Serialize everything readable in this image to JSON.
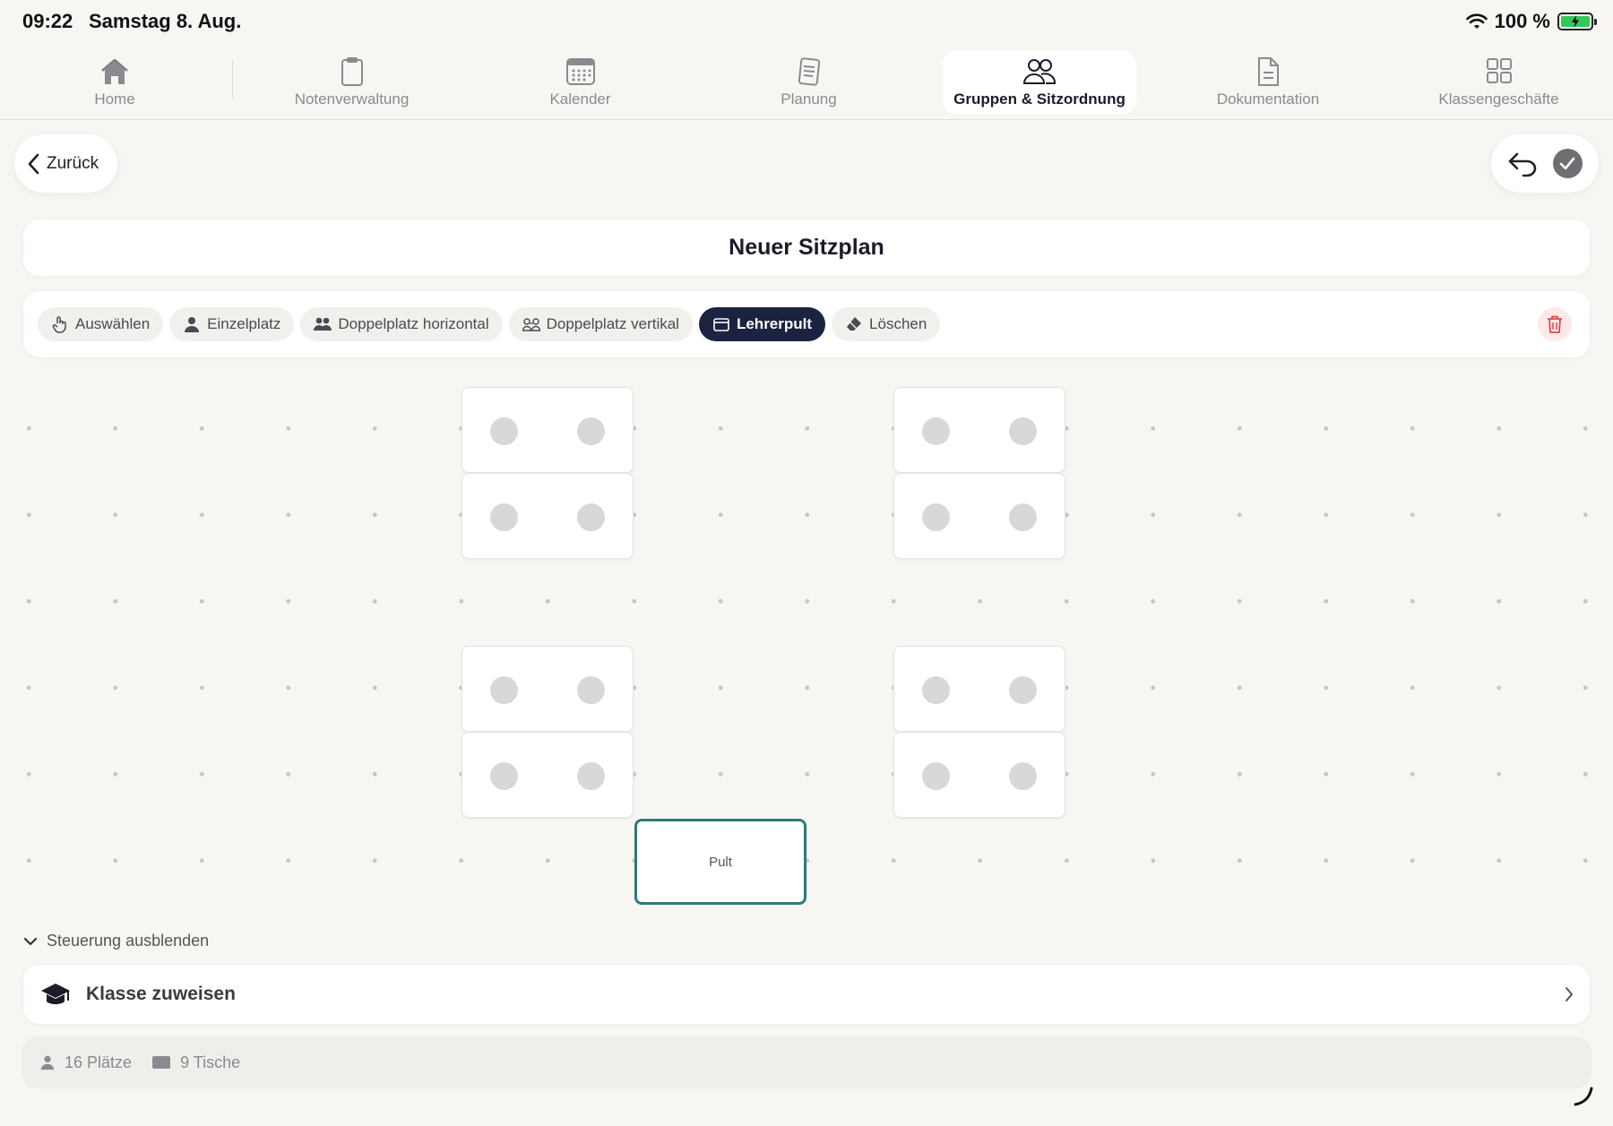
{
  "status_bar": {
    "time": "09:22",
    "date": "Samstag 8. Aug.",
    "battery": "100 %"
  },
  "nav": {
    "tabs": [
      {
        "label": "Home",
        "icon": "home-icon"
      },
      {
        "label": "Notenverwaltung",
        "icon": "clipboard-icon"
      },
      {
        "label": "Kalender",
        "icon": "calendar-icon"
      },
      {
        "label": "Planung",
        "icon": "document-icon"
      },
      {
        "label": "Gruppen & Sitzordnung",
        "icon": "people-icon",
        "active": true
      },
      {
        "label": "Dokumentation",
        "icon": "file-icon"
      },
      {
        "label": "Klassengeschäfte",
        "icon": "grid-icon"
      }
    ]
  },
  "header": {
    "back_label": "Zurück"
  },
  "plan": {
    "title": "Neuer Sitzplan"
  },
  "toolbar": {
    "tools": [
      {
        "label": "Auswählen",
        "icon": "hand-pointer-icon"
      },
      {
        "label": "Einzelplatz",
        "icon": "person-icon"
      },
      {
        "label": "Doppelplatz horizontal",
        "icon": "two-people-icon"
      },
      {
        "label": "Doppelplatz vertikal",
        "icon": "two-people-outline-icon"
      },
      {
        "label": "Lehrerpult",
        "icon": "desk-icon",
        "active": true
      },
      {
        "label": "Löschen",
        "icon": "eraser-icon"
      }
    ]
  },
  "canvas": {
    "desk_label": "Pult"
  },
  "controls": {
    "hide_label": "Steuerung ausblenden",
    "assign_label": "Klasse zuweisen"
  },
  "stats": {
    "seats": "16 Plätze",
    "tables": "9 Tische"
  },
  "colors": {
    "accent_dark": "#1c2340",
    "pult_border": "#2e7a7c",
    "danger": "#e0454b",
    "battery": "#34c759"
  }
}
